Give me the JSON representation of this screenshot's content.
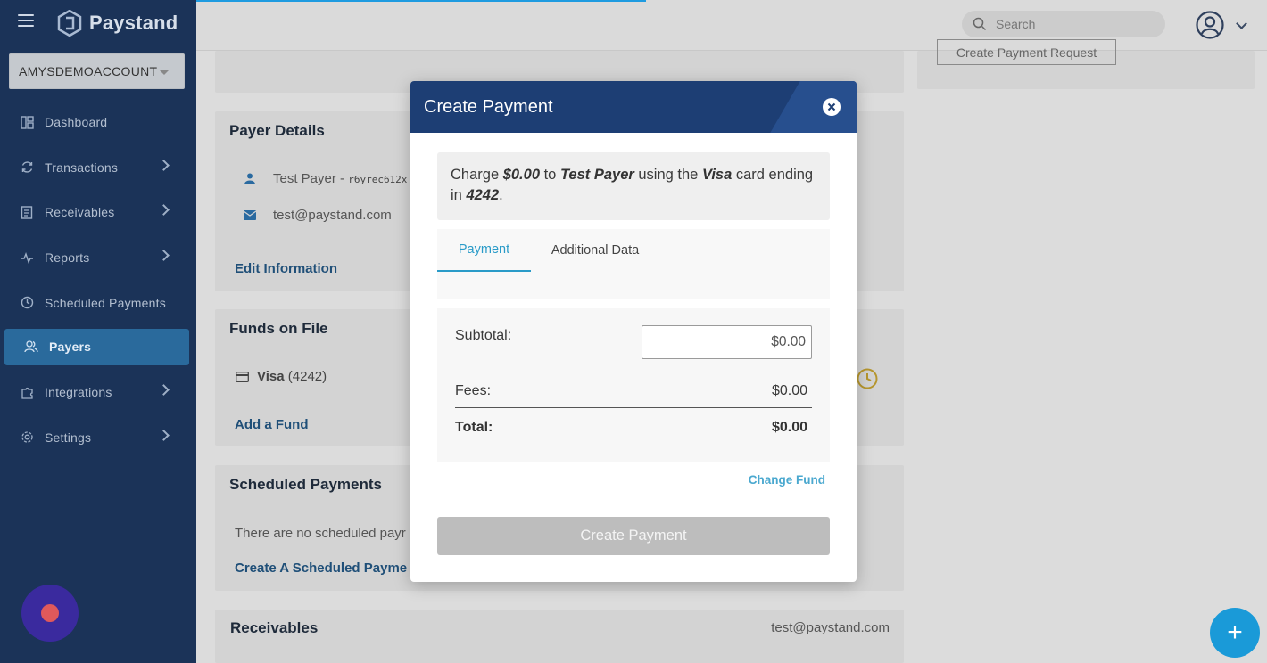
{
  "app": {
    "name": "Paystand"
  },
  "account": {
    "name": "AMYSDEMOACCOUNT"
  },
  "nav": [
    {
      "label": "Dashboard",
      "icon": "dashboard-icon",
      "has_children": false
    },
    {
      "label": "Transactions",
      "icon": "refresh-icon",
      "has_children": true
    },
    {
      "label": "Receivables",
      "icon": "document-icon",
      "has_children": true
    },
    {
      "label": "Reports",
      "icon": "activity-icon",
      "has_children": true
    },
    {
      "label": "Scheduled Payments",
      "icon": "clock-icon",
      "has_children": false
    },
    {
      "label": "Payers",
      "icon": "users-icon",
      "has_children": false,
      "active": true
    },
    {
      "label": "Integrations",
      "icon": "puzzle-icon",
      "has_children": true
    },
    {
      "label": "Settings",
      "icon": "gear-icon",
      "has_children": true
    }
  ],
  "topbar": {
    "search_placeholder": "Search"
  },
  "header_action": {
    "label": "Create Payment Request"
  },
  "payer_details": {
    "title": "Payer Details",
    "name": "Test Payer - ",
    "id": "r6yrec612x",
    "email": "test@paystand.com",
    "edit_link": "Edit Information"
  },
  "funds": {
    "title": "Funds on File",
    "fund_name": "Visa",
    "fund_last4": "(4242)",
    "add_link": "Add a Fund"
  },
  "scheduled": {
    "title": "Scheduled Payments",
    "empty_text": "There are no scheduled payr",
    "create_link": "Create A Scheduled Payme"
  },
  "receivables": {
    "title": "Receivables",
    "email": "test@paystand.com"
  },
  "modal": {
    "title": "Create Payment",
    "summary": {
      "prefix": "Charge ",
      "amount": "$0.00",
      "to": " to ",
      "payer": "Test Payer",
      "using": " using the ",
      "card": "Visa",
      "ending": " card ending in ",
      "last4": "4242",
      "suffix": "."
    },
    "tabs": [
      {
        "label": "Payment",
        "active": true
      },
      {
        "label": "Additional Data",
        "active": false
      }
    ],
    "subtotal_label": "Subtotal:",
    "subtotal_value": "$0.00",
    "fees_label": "Fees:",
    "fees_value": "$0.00",
    "total_label": "Total:",
    "total_value": "$0.00",
    "change_fund": "Change Fund",
    "submit_label": "Create Payment"
  },
  "colors": {
    "sidebar": "#1b3358",
    "modal_header": "#1d3e74",
    "accent": "#2a9bc8",
    "fab": "#1a9ad8"
  }
}
